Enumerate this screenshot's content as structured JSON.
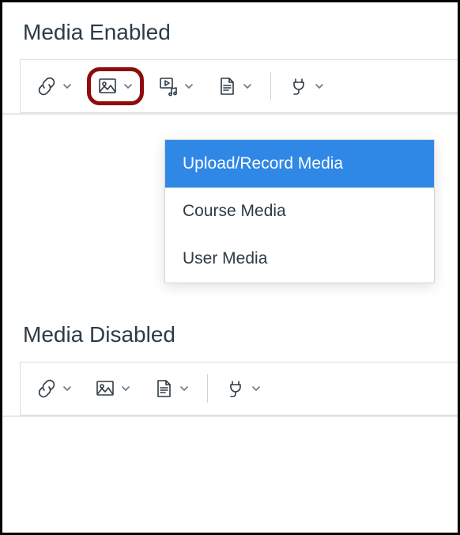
{
  "sections": {
    "enabled_title": "Media Enabled",
    "disabled_title": "Media Disabled"
  },
  "dropdown": {
    "items": [
      {
        "label": "Upload/Record Media",
        "selected": true
      },
      {
        "label": "Course Media",
        "selected": false
      },
      {
        "label": "User Media",
        "selected": false
      }
    ]
  },
  "tools": {
    "link": "link-icon",
    "image": "image-icon",
    "media": "media-icon",
    "document": "document-icon",
    "plugin": "plugin-icon"
  },
  "colors": {
    "iconStroke": "#2d3b45",
    "chevStroke": "#6f7780",
    "highlight": "#8d0c0c",
    "dropdownSelected": "#2f87e6"
  }
}
